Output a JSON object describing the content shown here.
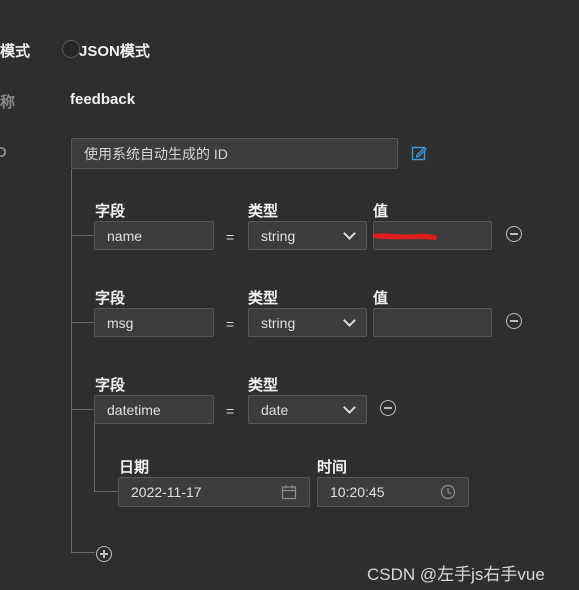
{
  "mode": {
    "partial_label": "模式",
    "json_mode_label": "JSON模式"
  },
  "name_row": {
    "partial_label": "称",
    "value": "feedback"
  },
  "id_row": {
    "partial_label": "D",
    "placeholder": "使用系统自动生成的 ID",
    "edit_icon": "edit-icon"
  },
  "fields": [
    {
      "field_label": "字段",
      "type_label": "类型",
      "value_label": "值",
      "field": "name",
      "type": "string",
      "value": ""
    },
    {
      "field_label": "字段",
      "type_label": "类型",
      "value_label": "值",
      "field": "msg",
      "type": "string",
      "value": ""
    },
    {
      "field_label": "字段",
      "type_label": "类型",
      "field": "datetime",
      "type": "date",
      "date_label": "日期",
      "date_value": "2022-11-17",
      "time_label": "时间",
      "time_value": "10:20:45"
    }
  ],
  "equals": "=",
  "add_icon": "plus-circle-icon",
  "remove_icon": "minus-circle-icon",
  "watermark": "CSDN @左手js右手vue",
  "colors": {
    "background": "#2e2e2e",
    "input_bg": "#3c3c3c",
    "edit_icon": "#3a9be0",
    "redaction": "#e01e1e"
  }
}
